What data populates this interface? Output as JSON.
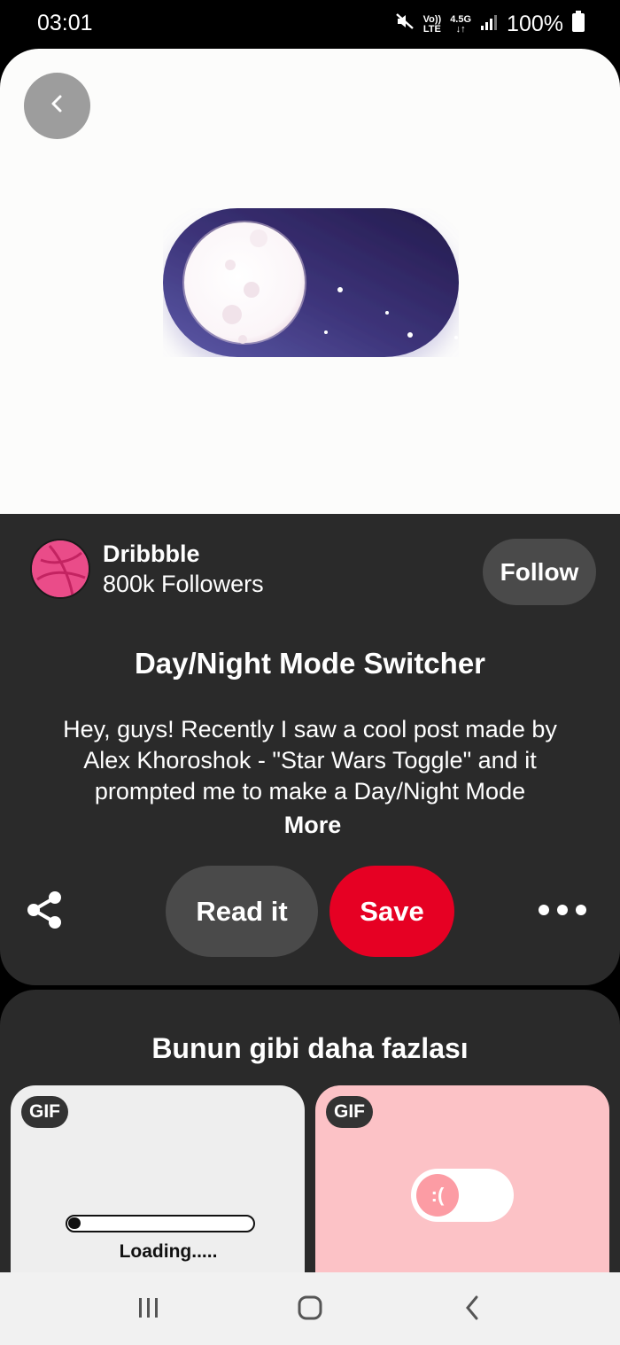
{
  "status_bar": {
    "time": "03:01",
    "volte_line1": "Vo))",
    "volte_line2": "LTE",
    "network_line1": "4.5G",
    "network_line2": "↓↑",
    "battery": "100%",
    "icons": [
      "mute-icon",
      "volte-icon",
      "network-icon",
      "signal-icon",
      "battery-icon"
    ]
  },
  "hero": {
    "back_icon": "chevron-left-icon",
    "toggle_colors": {
      "track_dark": "#2b1f55",
      "track_light": "#5a57a5",
      "moon": "#ffffff"
    }
  },
  "creator": {
    "name": "Dribbble",
    "followers": "800k Followers",
    "follow_label": "Follow",
    "avatar_icon": "dribbble-icon"
  },
  "pin": {
    "title": "Day/Night Mode Switcher",
    "description": "Hey, guys! Recently I saw a cool post made by Alex Khoroshok - \"Star Wars Toggle\" and it prompted me to make a Day/Night Mode",
    "more_label": "More"
  },
  "actions": {
    "share_icon": "share-icon",
    "read_it_label": "Read it",
    "save_label": "Save",
    "more_icon": "more-icon",
    "save_color": "#e60023"
  },
  "more_like_this": {
    "title": "Bunun gibi daha fazlası",
    "cards": [
      {
        "badge": "GIF",
        "loading_text": "Loading....."
      },
      {
        "badge": "GIF",
        "face": ":("
      }
    ]
  },
  "nav_bar": {
    "icons": [
      "recents-icon",
      "home-icon",
      "back-icon"
    ]
  }
}
